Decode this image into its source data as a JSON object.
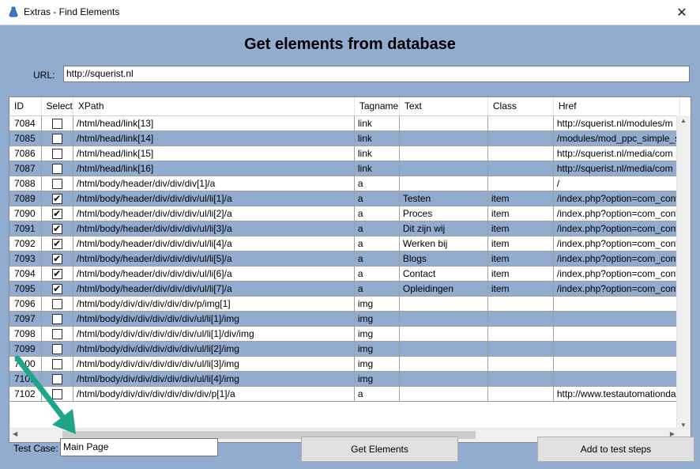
{
  "window": {
    "title": "Extras - Find Elements",
    "close": "✕"
  },
  "heading": "Get elements from database",
  "url": {
    "label": "URL:",
    "value": "http://squerist.nl"
  },
  "grid": {
    "columns": [
      "ID",
      "Select",
      "XPath",
      "Tagname",
      "Text",
      "Class",
      "Href"
    ],
    "rows": [
      {
        "id": "7084",
        "select": false,
        "xpath": "/html/head/link[13]",
        "tag": "link",
        "text": "",
        "cls": "",
        "href": "http://squerist.nl/modules/m"
      },
      {
        "id": "7085",
        "select": false,
        "xpath": "/html/head/link[14]",
        "tag": "link",
        "text": "",
        "cls": "",
        "href": "/modules/mod_ppc_simple_s"
      },
      {
        "id": "7086",
        "select": false,
        "xpath": "/html/head/link[15]",
        "tag": "link",
        "text": "",
        "cls": "",
        "href": "http://squerist.nl/media/com"
      },
      {
        "id": "7087",
        "select": false,
        "xpath": "/html/head/link[16]",
        "tag": "link",
        "text": "",
        "cls": "",
        "href": "http://squerist.nl/media/com"
      },
      {
        "id": "7088",
        "select": false,
        "xpath": "/html/body/header/div/div/div[1]/a",
        "tag": "a",
        "text": "",
        "cls": "",
        "href": "/"
      },
      {
        "id": "7089",
        "select": true,
        "xpath": "/html/body/header/div/div/div/ul/li[1]/a",
        "tag": "a",
        "text": "Testen",
        "cls": "item",
        "href": "/index.php?option=com_cont"
      },
      {
        "id": "7090",
        "select": true,
        "xpath": "/html/body/header/div/div/div/ul/li[2]/a",
        "tag": "a",
        "text": "Proces",
        "cls": "item",
        "href": "/index.php?option=com_cont"
      },
      {
        "id": "7091",
        "select": true,
        "xpath": "/html/body/header/div/div/div/ul/li[3]/a",
        "tag": "a",
        "text": "Dit zijn wij",
        "cls": "item",
        "href": "/index.php?option=com_cont"
      },
      {
        "id": "7092",
        "select": true,
        "xpath": "/html/body/header/div/div/div/ul/li[4]/a",
        "tag": "a",
        "text": "Werken bij",
        "cls": "item",
        "href": "/index.php?option=com_cont"
      },
      {
        "id": "7093",
        "select": true,
        "xpath": "/html/body/header/div/div/div/ul/li[5]/a",
        "tag": "a",
        "text": "Blogs",
        "cls": "item",
        "href": "/index.php?option=com_cont"
      },
      {
        "id": "7094",
        "select": true,
        "xpath": "/html/body/header/div/div/div/ul/li[6]/a",
        "tag": "a",
        "text": "Contact",
        "cls": "item",
        "href": "/index.php?option=com_cont"
      },
      {
        "id": "7095",
        "select": true,
        "xpath": "/html/body/header/div/div/div/ul/li[7]/a",
        "tag": "a",
        "text": "Opleidingen",
        "cls": "item",
        "href": "/index.php?option=com_cont"
      },
      {
        "id": "7096",
        "select": false,
        "xpath": "/html/body/div/div/div/div/div/p/img[1]",
        "tag": "img",
        "text": "",
        "cls": "",
        "href": ""
      },
      {
        "id": "7097",
        "select": false,
        "xpath": "/html/body/div/div/div/div/div/ul/li[1]/img",
        "tag": "img",
        "text": "",
        "cls": "",
        "href": ""
      },
      {
        "id": "7098",
        "select": false,
        "xpath": "/html/body/div/div/div/div/div/ul/li[1]/div/img",
        "tag": "img",
        "text": "",
        "cls": "",
        "href": ""
      },
      {
        "id": "7099",
        "select": false,
        "xpath": "/html/body/div/div/div/div/div/ul/li[2]/img",
        "tag": "img",
        "text": "",
        "cls": "",
        "href": ""
      },
      {
        "id": "7100",
        "select": false,
        "xpath": "/html/body/div/div/div/div/div/ul/li[3]/img",
        "tag": "img",
        "text": "",
        "cls": "",
        "href": ""
      },
      {
        "id": "7101",
        "select": false,
        "xpath": "/html/body/div/div/div/div/div/ul/li[4]/img",
        "tag": "img",
        "text": "",
        "cls": "",
        "href": ""
      },
      {
        "id": "7102",
        "select": false,
        "xpath": "/html/body/div/div/div/div/div/div/p[1]/a",
        "tag": "a",
        "text": "",
        "cls": "",
        "href": "http://www.testautomationda"
      }
    ]
  },
  "test_case": {
    "label": "Test Case:",
    "value": "Main Page"
  },
  "buttons": {
    "get_elements": "Get Elements",
    "add_to_steps": "Add to test steps"
  },
  "colors": {
    "background": "#91accf",
    "annotation_arrow": "#1fa58a"
  }
}
